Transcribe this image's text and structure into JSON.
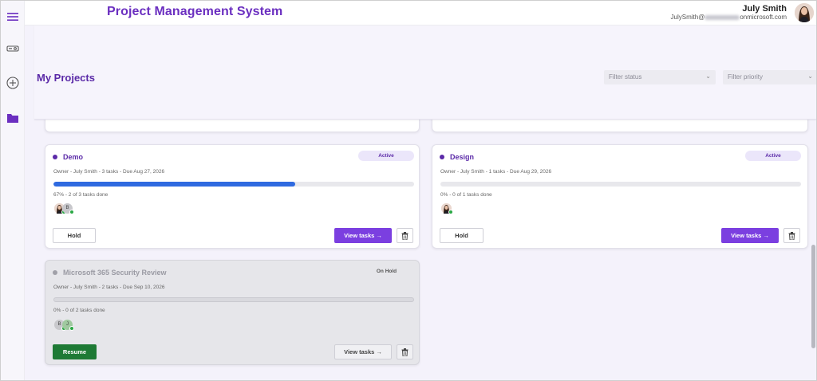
{
  "app": {
    "title": "Project Management System"
  },
  "user": {
    "name": "July Smith",
    "email_prefix": "JulySmith@",
    "email_suffix": "onmicrosoft.com"
  },
  "sidebar": {
    "items": [
      {
        "icon": "menu-icon"
      },
      {
        "icon": "projector-icon"
      },
      {
        "icon": "add-circle-icon"
      },
      {
        "icon": "folder-icon"
      }
    ]
  },
  "page": {
    "title": "My Projects"
  },
  "filters": {
    "status_placeholder": "Filter status",
    "priority_placeholder": "Filter priority"
  },
  "colors": {
    "accent": "#7b3fe0",
    "title_purple": "#5b2aa8",
    "progress_blue": "#2f6ae0",
    "resume_green": "#1e7a35",
    "presence_green": "#2aa845"
  },
  "projects": [
    {
      "name": "Demo",
      "status": "Active",
      "meta": "Owner - July Smith - 3 tasks - Due Aug 27, 2026",
      "progress_text": "67% - 2 of 3 tasks done",
      "progress": 0.67,
      "members": [
        "photo",
        "B"
      ],
      "hold_label": "Hold",
      "view_label": "View tasks →"
    },
    {
      "name": "Design",
      "status": "Active",
      "meta": "Owner - July Smith - 1 tasks - Due Aug 29, 2026",
      "progress_text": "0% - 0 of 1 tasks done",
      "progress": 0,
      "members": [
        "photo"
      ],
      "hold_label": "Hold",
      "view_label": "View tasks →"
    },
    {
      "name": "Microsoft 365 Security Review",
      "status": "On Hold",
      "meta": "Owner - July Smith - 2 tasks - Due Sep 10, 2026",
      "progress_text": "0% - 0 of 2 tasks done",
      "progress": 0,
      "members": [
        "B",
        "J"
      ],
      "resume_label": "Resume",
      "view_label": "View tasks →"
    }
  ]
}
